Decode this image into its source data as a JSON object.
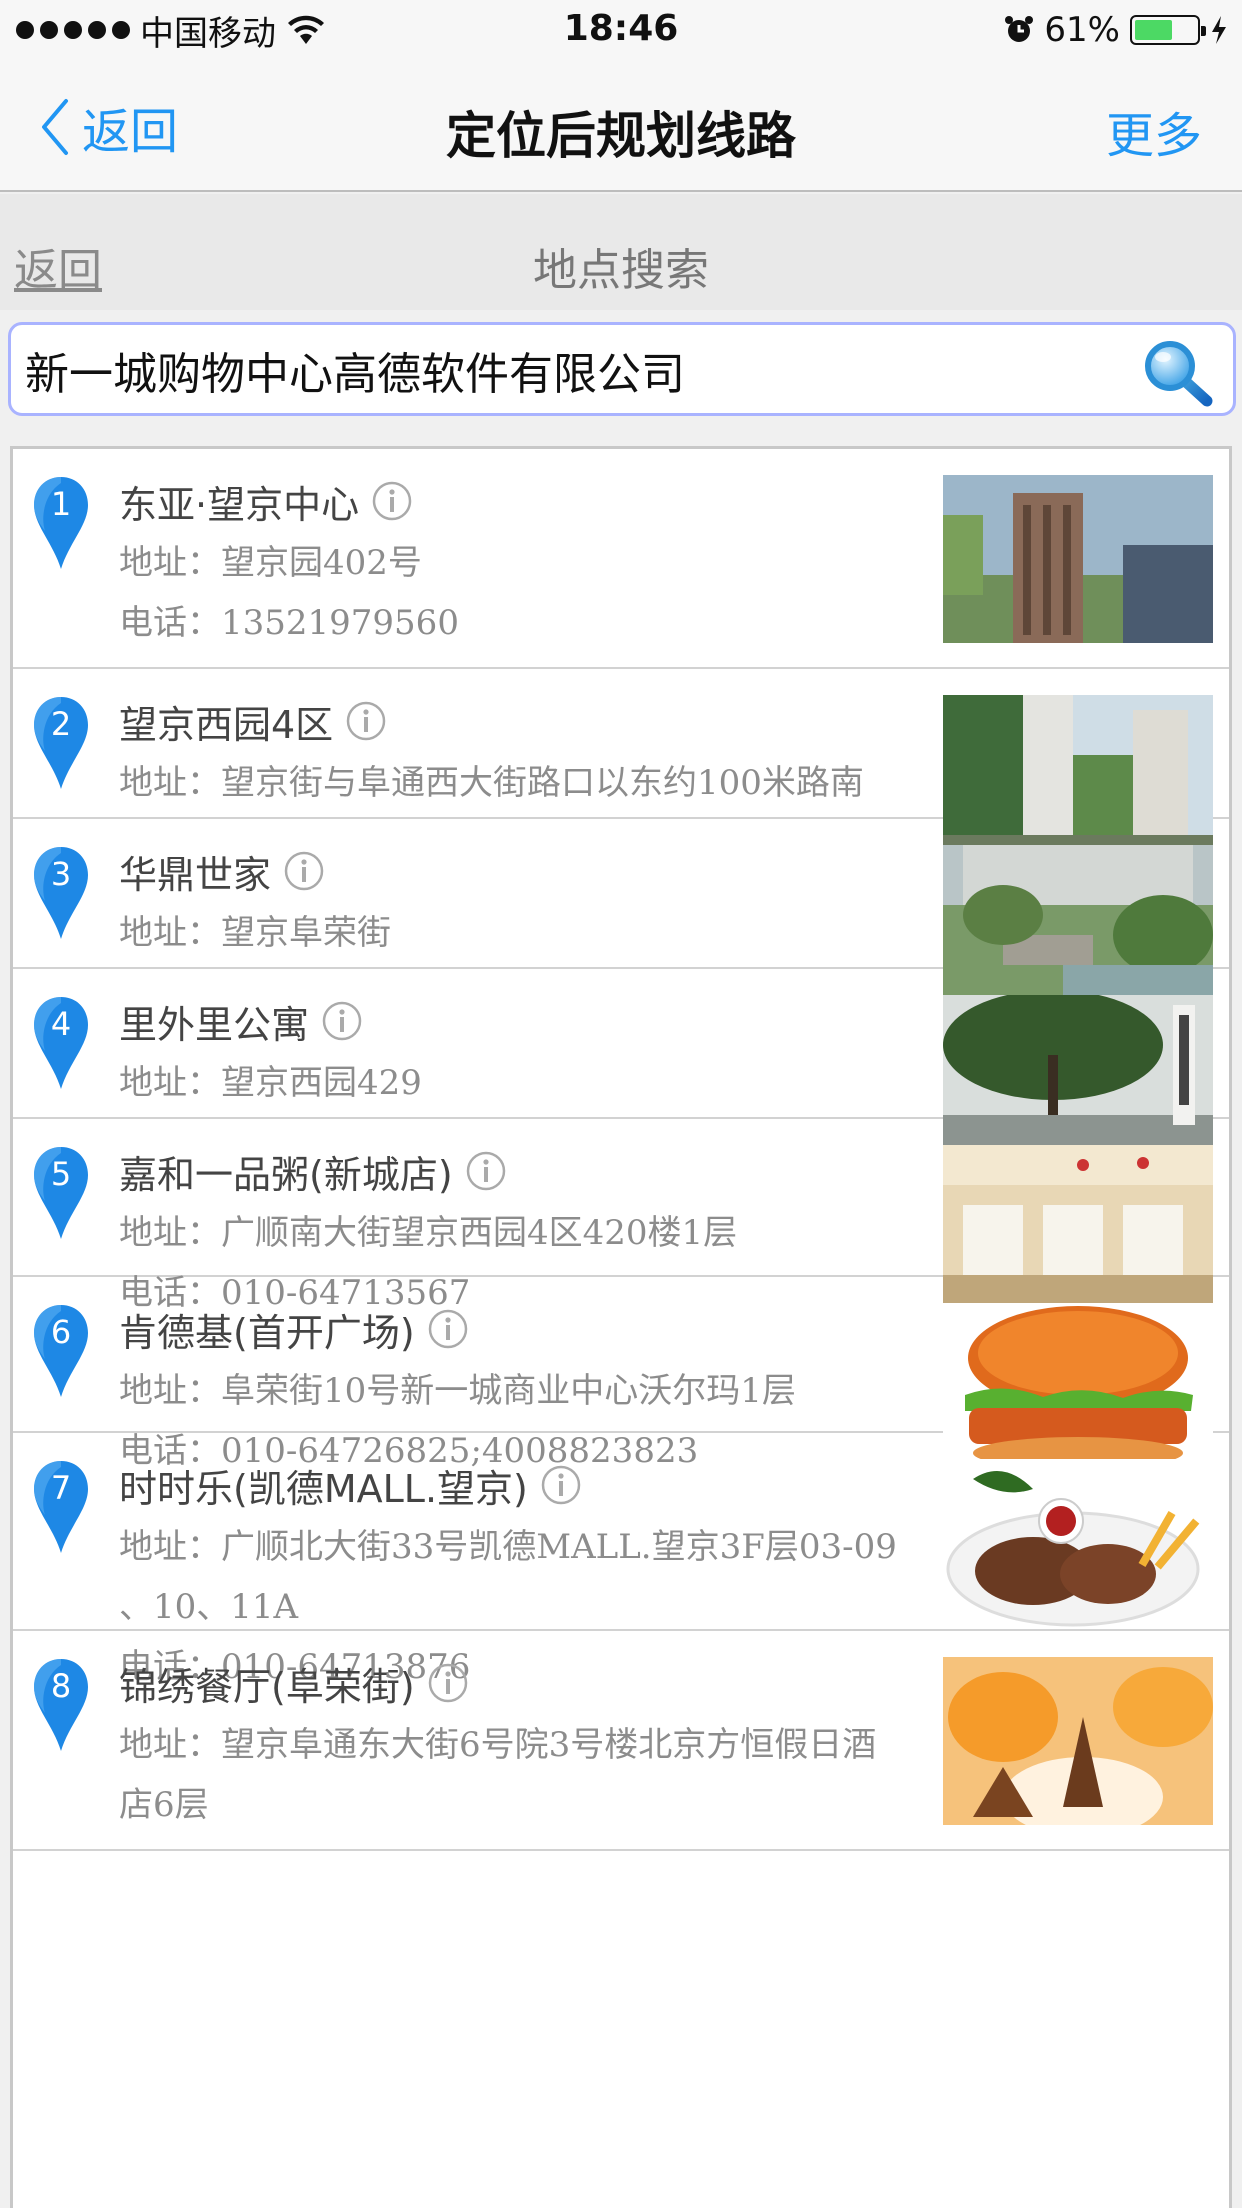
{
  "status_bar": {
    "carrier": "中国移动",
    "time": "18:46",
    "battery_percent": "61%",
    "battery_level": 0.61
  },
  "nav": {
    "back_label": "返回",
    "title": "定位后规划线路",
    "more_label": "更多"
  },
  "sub_header": {
    "back_label": "返回",
    "title": "地点搜索"
  },
  "search": {
    "value": "新一城购物中心高德软件有限公司"
  },
  "colors": {
    "accent": "#2196f3",
    "pin": "#1e88e5",
    "battery": "#4cd964"
  },
  "results": [
    {
      "num": "1",
      "name": "东亚·望京中心",
      "address_label": "地址：",
      "address": "望京园402号",
      "phone_label": "电话：",
      "phone": "13521979560",
      "thumb": "building-photo"
    },
    {
      "num": "2",
      "name": "望京西园4区",
      "address_label": "地址：",
      "address": "望京街与阜通西大街路口以东约100米路南",
      "thumb": "towers-photo"
    },
    {
      "num": "3",
      "name": "华鼎世家",
      "address_label": "地址：",
      "address": "望京阜荣街",
      "thumb": "garden-photo"
    },
    {
      "num": "4",
      "name": "里外里公寓",
      "address_label": "地址：",
      "address": "望京西园429",
      "thumb": "park-photo"
    },
    {
      "num": "5",
      "name": "嘉和一品粥(新城店)",
      "address_label": "地址：",
      "address": "广顺南大街望京西园4区420楼1层",
      "phone_label": "电话：",
      "phone": "010-64713567",
      "thumb": "restaurant-photo"
    },
    {
      "num": "6",
      "name": "肯德基(首开广场)",
      "address_label": "地址：",
      "address": "阜荣街10号新一城商业中心沃尔玛1层",
      "phone_label": "电话：",
      "phone": "010-64726825;4008823823",
      "thumb": "burger-photo"
    },
    {
      "num": "7",
      "name": "时时乐(凯德MALL.望京)",
      "address_label": "地址：",
      "address": "广顺北大街33号凯德MALL.望京3F层03-09",
      "address_cont": "、10、11A",
      "phone_label": "电话：",
      "phone": "010-64713876",
      "thumb": "steak-photo"
    },
    {
      "num": "8",
      "name": "锦绣餐厅(阜荣街)",
      "address_label": "地址：",
      "address": "望京阜通东大街6号院3号楼北京方恒假日酒",
      "address_cont": "店6层",
      "thumb": "dessert-photo"
    }
  ]
}
